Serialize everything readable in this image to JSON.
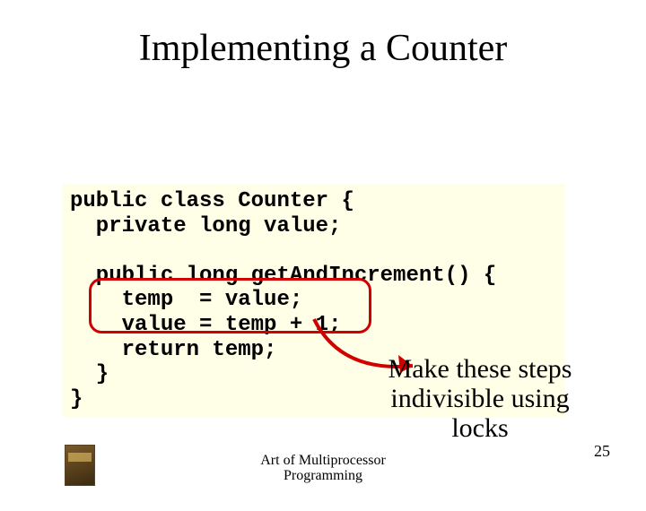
{
  "title": "Implementing a Counter",
  "code": {
    "l1": "public class Counter {",
    "l2": "  private long value;",
    "l3": "",
    "l4": "  public long getAndIncrement() {",
    "l5": "    temp  = value;",
    "l6": "    value = temp + 1;",
    "l7": "    return temp;",
    "l8": "  }",
    "l9": "}"
  },
  "callout": {
    "line1": "Make these steps",
    "line2_pre": "indivisible",
    "line2_post": " using",
    "line3": "locks"
  },
  "footer": {
    "line1": "Art of Multiprocessor",
    "line2": "Programming"
  },
  "page_number": "25"
}
